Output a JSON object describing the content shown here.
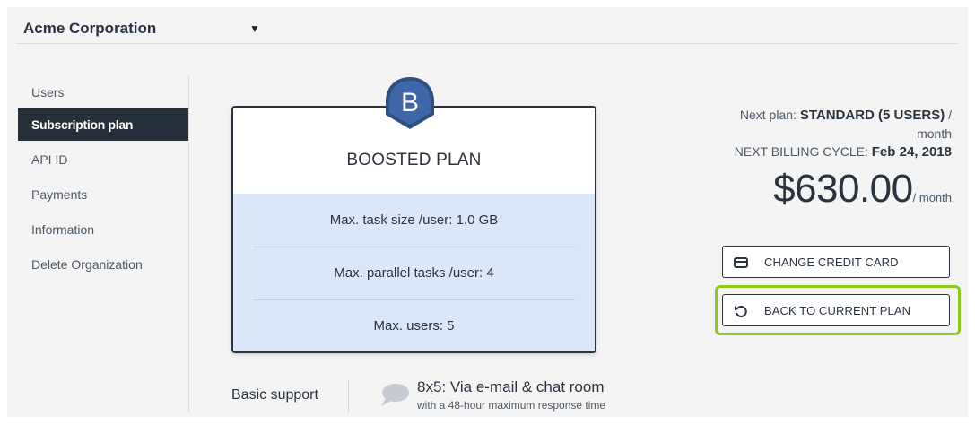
{
  "organization": {
    "name": "Acme Corporation"
  },
  "sidebar": {
    "items": [
      {
        "label": "Users",
        "active": false
      },
      {
        "label": "Subscription plan",
        "active": true
      },
      {
        "label": "API ID",
        "active": false
      },
      {
        "label": "Payments",
        "active": false
      },
      {
        "label": "Information",
        "active": false
      },
      {
        "label": "Delete Organization",
        "active": false
      }
    ]
  },
  "plan": {
    "badge_letter": "B",
    "title": "BOOSTED PLAN",
    "features": [
      "Max. task size /user: 1.0 GB",
      "Max. parallel tasks /user: 4",
      "Max. users: 5"
    ]
  },
  "support": {
    "label": "Basic support",
    "main": "8x5: Via e-mail & chat room",
    "sub": "with a 48-hour maximum response time"
  },
  "billing": {
    "next_plan_prefix": "Next plan: ",
    "next_plan_name": "STANDARD (5 USERS)",
    "next_plan_suffix": " /",
    "next_plan_period": "month",
    "cycle_prefix": "NEXT BILLING CYCLE: ",
    "cycle_date": "Feb 24, 2018",
    "price": "$630.00",
    "price_period": "/ month"
  },
  "buttons": {
    "change_card": "CHANGE CREDIT CARD",
    "back_to_current": "BACK TO CURRENT PLAN"
  },
  "colors": {
    "sidebar_active": "#25303b",
    "plan_body": "#dbe6fa",
    "highlight": "#8ccb1e",
    "badge": "#2f4f7e"
  }
}
